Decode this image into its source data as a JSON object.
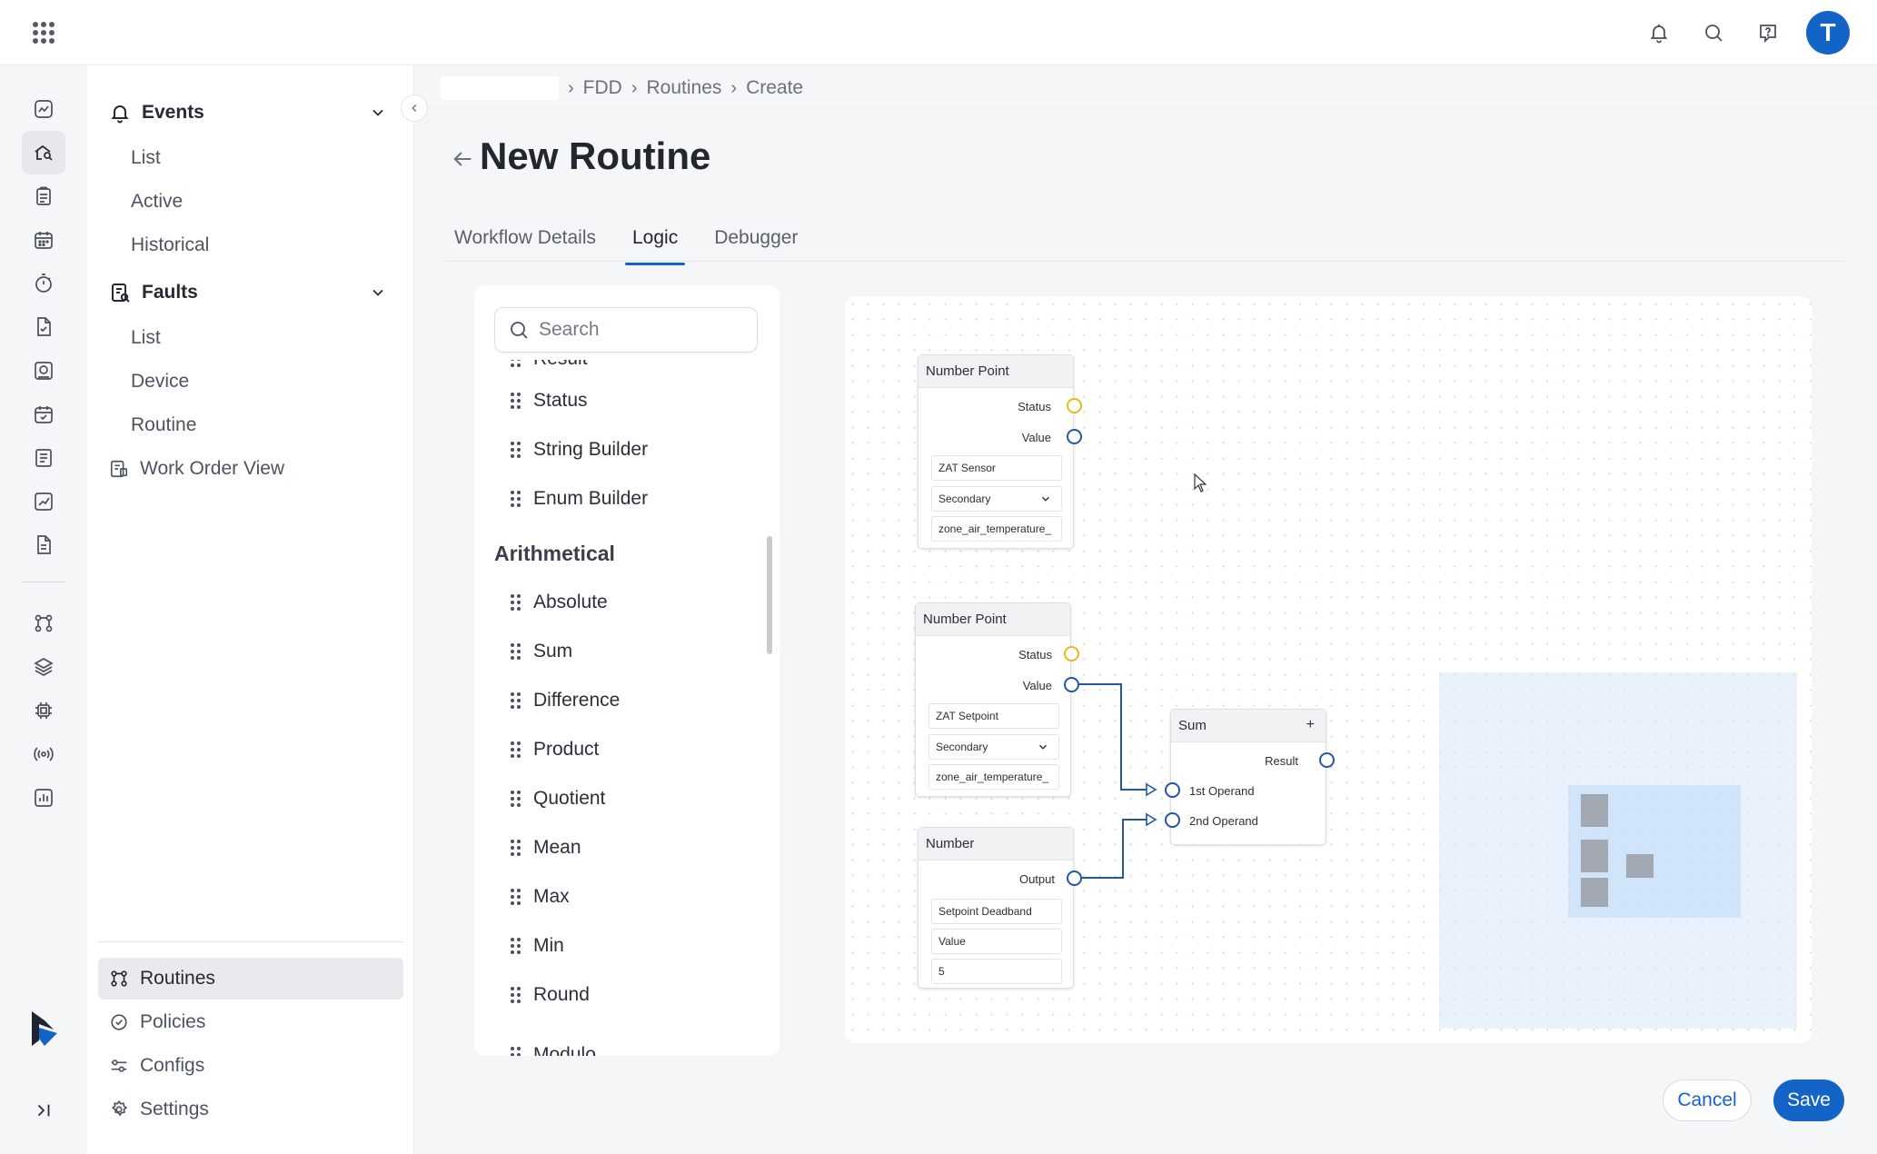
{
  "header": {
    "apps_icon": "apps-grid-icon",
    "icons": [
      "bell-icon",
      "search-icon",
      "help-icon"
    ],
    "avatar_initial": "T",
    "accent_color": "#1464c8"
  },
  "rail": {
    "icons": [
      "analytics-icon",
      "home-search-icon",
      "checklist-icon",
      "calendar-icon",
      "timer-icon",
      "file-check-icon",
      "reports-icon",
      "calendar-check-icon",
      "document-list-icon",
      "chart-icon",
      "document-icon",
      "workflow-icon",
      "layers-icon",
      "chip-icon",
      "broadcast-icon",
      "bar-chart-icon"
    ],
    "logo": "brand-logo",
    "expand_icon": "expand-rail-icon"
  },
  "nav": {
    "sections": [
      {
        "label": "Events",
        "items": [
          "List",
          "Active",
          "Historical"
        ]
      },
      {
        "label": "Faults",
        "items": [
          "List",
          "Device",
          "Routine"
        ]
      }
    ],
    "work_order_view": "Work Order View",
    "bottom": [
      "Routines",
      "Policies",
      "Configs",
      "Settings"
    ]
  },
  "breadcrumb": [
    "FDD",
    "Routines",
    "Create"
  ],
  "page": {
    "title": "New Routine",
    "tabs": [
      "Workflow Details",
      "Logic",
      "Debugger"
    ],
    "active_tab": "Logic"
  },
  "palette": {
    "search_placeholder": "Search",
    "partial_top": "Result",
    "items_top": [
      "Status",
      "String Builder",
      "Enum Builder"
    ],
    "section": "Arithmetical",
    "items": [
      "Absolute",
      "Sum",
      "Difference",
      "Product",
      "Quotient",
      "Mean",
      "Max",
      "Min",
      "Round"
    ],
    "partial_bottom": "Modulo"
  },
  "nodes": {
    "np1": {
      "title": "Number Point",
      "status": "Status",
      "value": "Value",
      "name": "ZAT Sensor",
      "priority": "Secondary",
      "tag": "zone_air_temperature_"
    },
    "np2": {
      "title": "Number Point",
      "status": "Status",
      "value": "Value",
      "name": "ZAT Setpoint",
      "priority": "Secondary",
      "tag": "zone_air_temperature_"
    },
    "num": {
      "title": "Number",
      "output": "Output",
      "name": "Setpoint Deadband",
      "field": "Value",
      "value": "5"
    },
    "sum": {
      "title": "Sum",
      "plus": "+",
      "result": "Result",
      "op1": "1st Operand",
      "op2": "2nd Operand"
    }
  },
  "colors": {
    "port": "#2357a6",
    "status_port": "#e8b824",
    "wire": "#2357a6"
  },
  "actions": {
    "cancel": "Cancel",
    "save": "Save"
  }
}
